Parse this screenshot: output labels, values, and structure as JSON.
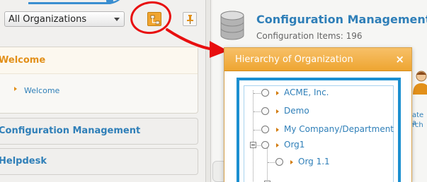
{
  "org_selector": {
    "value": "All Organizations"
  },
  "menu": {
    "welcome": {
      "title": "Welcome",
      "items": [
        {
          "label": "Welcome"
        }
      ]
    },
    "configuration": {
      "title": "Configuration Management"
    },
    "helpdesk": {
      "title": "Helpdesk"
    }
  },
  "header": {
    "title": "Configuration Management",
    "items_label": "Configuration Items: 196"
  },
  "background_fragments": {
    "line1": "ate a",
    "line2": "rch"
  },
  "popup": {
    "title": "Hierarchy of Organization",
    "close_symbol": "×",
    "tree": [
      {
        "label": "ACME, Inc."
      },
      {
        "label": "Demo"
      },
      {
        "label": "My Company/Department"
      },
      {
        "label": "Org1",
        "expanded": true
      },
      {
        "label": "Org 1.1"
      }
    ]
  },
  "colors": {
    "accent_orange": "#eea531",
    "link_blue": "#2f7fb8",
    "annotation_red": "#e80f0f",
    "frame_blue": "#1b8fd0"
  }
}
